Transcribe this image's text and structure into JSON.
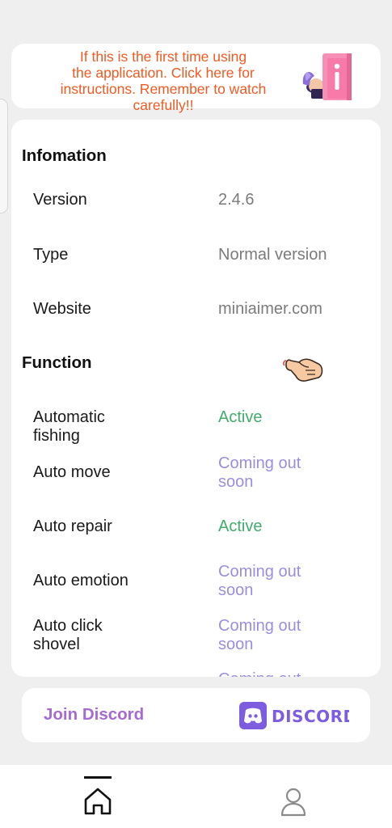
{
  "banner": {
    "lines": [
      "If this is the first time using",
      "the application. Click here for",
      "instructions. Remember to watch",
      "carefully!!"
    ]
  },
  "info": {
    "title": "Infomation",
    "rows": [
      {
        "label": "Version",
        "value": "2.4.6"
      },
      {
        "label": "Type",
        "value": "Normal version"
      },
      {
        "label": "Website",
        "value": "miniaimer.com"
      }
    ]
  },
  "function": {
    "title": "Function",
    "rows": [
      {
        "label_lines": [
          "Automatic",
          "fishing"
        ],
        "value_lines": [
          "Active"
        ],
        "status": "active"
      },
      {
        "label_lines": [
          "Auto move"
        ],
        "value_lines": [
          "Coming out",
          "soon"
        ],
        "status": "soon"
      },
      {
        "label_lines": [
          "Auto repair"
        ],
        "value_lines": [
          "Active"
        ],
        "status": "active"
      },
      {
        "label_lines": [
          "Auto emotion"
        ],
        "value_lines": [
          "Coming out",
          "soon"
        ],
        "status": "soon"
      },
      {
        "label_lines": [
          "Auto click",
          "shovel"
        ],
        "value_lines": [
          "Coming out",
          "soon"
        ],
        "status": "soon"
      },
      {
        "label_lines": [
          ""
        ],
        "value_lines": [
          "Coming out"
        ],
        "status": "soon"
      }
    ]
  },
  "discord": {
    "label": "Join Discord",
    "logo_text": "DISCORD",
    "brand_color": "#7d5ce0"
  },
  "colors": {
    "banner_text": "#f05a22",
    "active": "#41ad6b",
    "soon": "#9b8ee0",
    "discord_label": "#a56bd3"
  },
  "nav": {
    "items": [
      {
        "icon": "home-icon",
        "selected": true
      },
      {
        "icon": "user-icon",
        "selected": false
      }
    ]
  }
}
